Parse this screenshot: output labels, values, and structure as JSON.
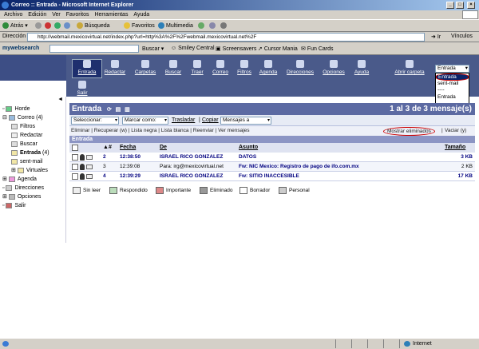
{
  "window": {
    "title": "Correo :: Entrada - Microsoft Internet Explorer"
  },
  "menubar": [
    "Archivo",
    "Edición",
    "Ver",
    "Favoritos",
    "Herramientas",
    "Ayuda"
  ],
  "toolbar": {
    "back": "Atrás",
    "search": "Búsqueda",
    "favorites": "Favoritos",
    "multimedia": "Multimedia"
  },
  "address": {
    "label": "Dirección",
    "url": "http://webmail.mexicovirtual.net/index.php?url=http%3A%2F%2Fwebmail.mexicovirtual.net%2F",
    "go": "Ir",
    "links": "Vínculos"
  },
  "mywebsearch": {
    "logo": "mywebsearch",
    "search_btn": "Buscar",
    "smiley": "Smiley Central",
    "screensavers": "Screensavers",
    "cursor": "Cursor Mania",
    "funcards": "Fun Cards"
  },
  "nav": {
    "items": [
      "Entrada",
      "Redactar",
      "Carpetas",
      "Buscar",
      "Traer",
      "Correo",
      "Filtros",
      "Agenda",
      "Direcciones",
      "Opciones",
      "Ayuda"
    ],
    "abrir": "Abrir carpeta",
    "salir": "Salir",
    "folder_selected": "Entrada",
    "folder_options": [
      "Entrada",
      "sent-mail",
      "----",
      "Entrada"
    ]
  },
  "sidebar": {
    "items": [
      {
        "label": "Horde"
      },
      {
        "label": "Correo",
        "count": "(4)"
      },
      {
        "label": "Filtros"
      },
      {
        "label": "Redactar"
      },
      {
        "label": "Buscar"
      },
      {
        "label": "Entrada",
        "count": "(4)"
      },
      {
        "label": "sent-mail"
      },
      {
        "label": "Virtuales"
      },
      {
        "label": "Agenda"
      },
      {
        "label": "Direcciones"
      },
      {
        "label": "Opciones"
      },
      {
        "label": "Salir"
      }
    ]
  },
  "mail": {
    "folder": "Entrada",
    "count_text": "1 al 3 de 3 mensaje(s)",
    "seleccionar": "Seleccionar:",
    "marcar": "Marcar como:",
    "trasladar": "Trasladar",
    "copiar": "Copiar",
    "mensajes_a": "Mensajes a",
    "actions": [
      "Eliminar",
      "Recuperar (w)",
      "Lista negra",
      "Lista blanca",
      "Reenviar",
      "Ver mensajes"
    ],
    "mostrar": "Mostrar eliminados",
    "vaciar": "Vaciar (y)",
    "subheader": "Entrada",
    "columns": {
      "num": "#",
      "fecha": "Fecha",
      "de": "De",
      "asunto": "Asunto",
      "tamano": "Tamaño"
    },
    "rows": [
      {
        "num": "2",
        "fecha": "12:38:50",
        "de": "ISRAEL RICO GONZALEZ",
        "asunto": "DATOS",
        "size": "3 KB",
        "bold": true
      },
      {
        "num": "3",
        "fecha": "12:39:08",
        "de": "Para: irg@mexicovirtual.net",
        "asunto": "Fw: NIC Mexico: Registro de pago de ifo.com.mx",
        "size": "2 KB",
        "bold": false
      },
      {
        "num": "4",
        "fecha": "12:39:29",
        "de": "ISRAEL RICO GONZALEZ",
        "asunto": "Fw: SITIO INACCESIBLE",
        "size": "17 KB",
        "bold": true
      }
    ],
    "legend": [
      "Sin leer",
      "Respondido",
      "Importante",
      "Eliminado",
      "Borrador",
      "Personal"
    ]
  },
  "status": {
    "zone": "Internet"
  }
}
